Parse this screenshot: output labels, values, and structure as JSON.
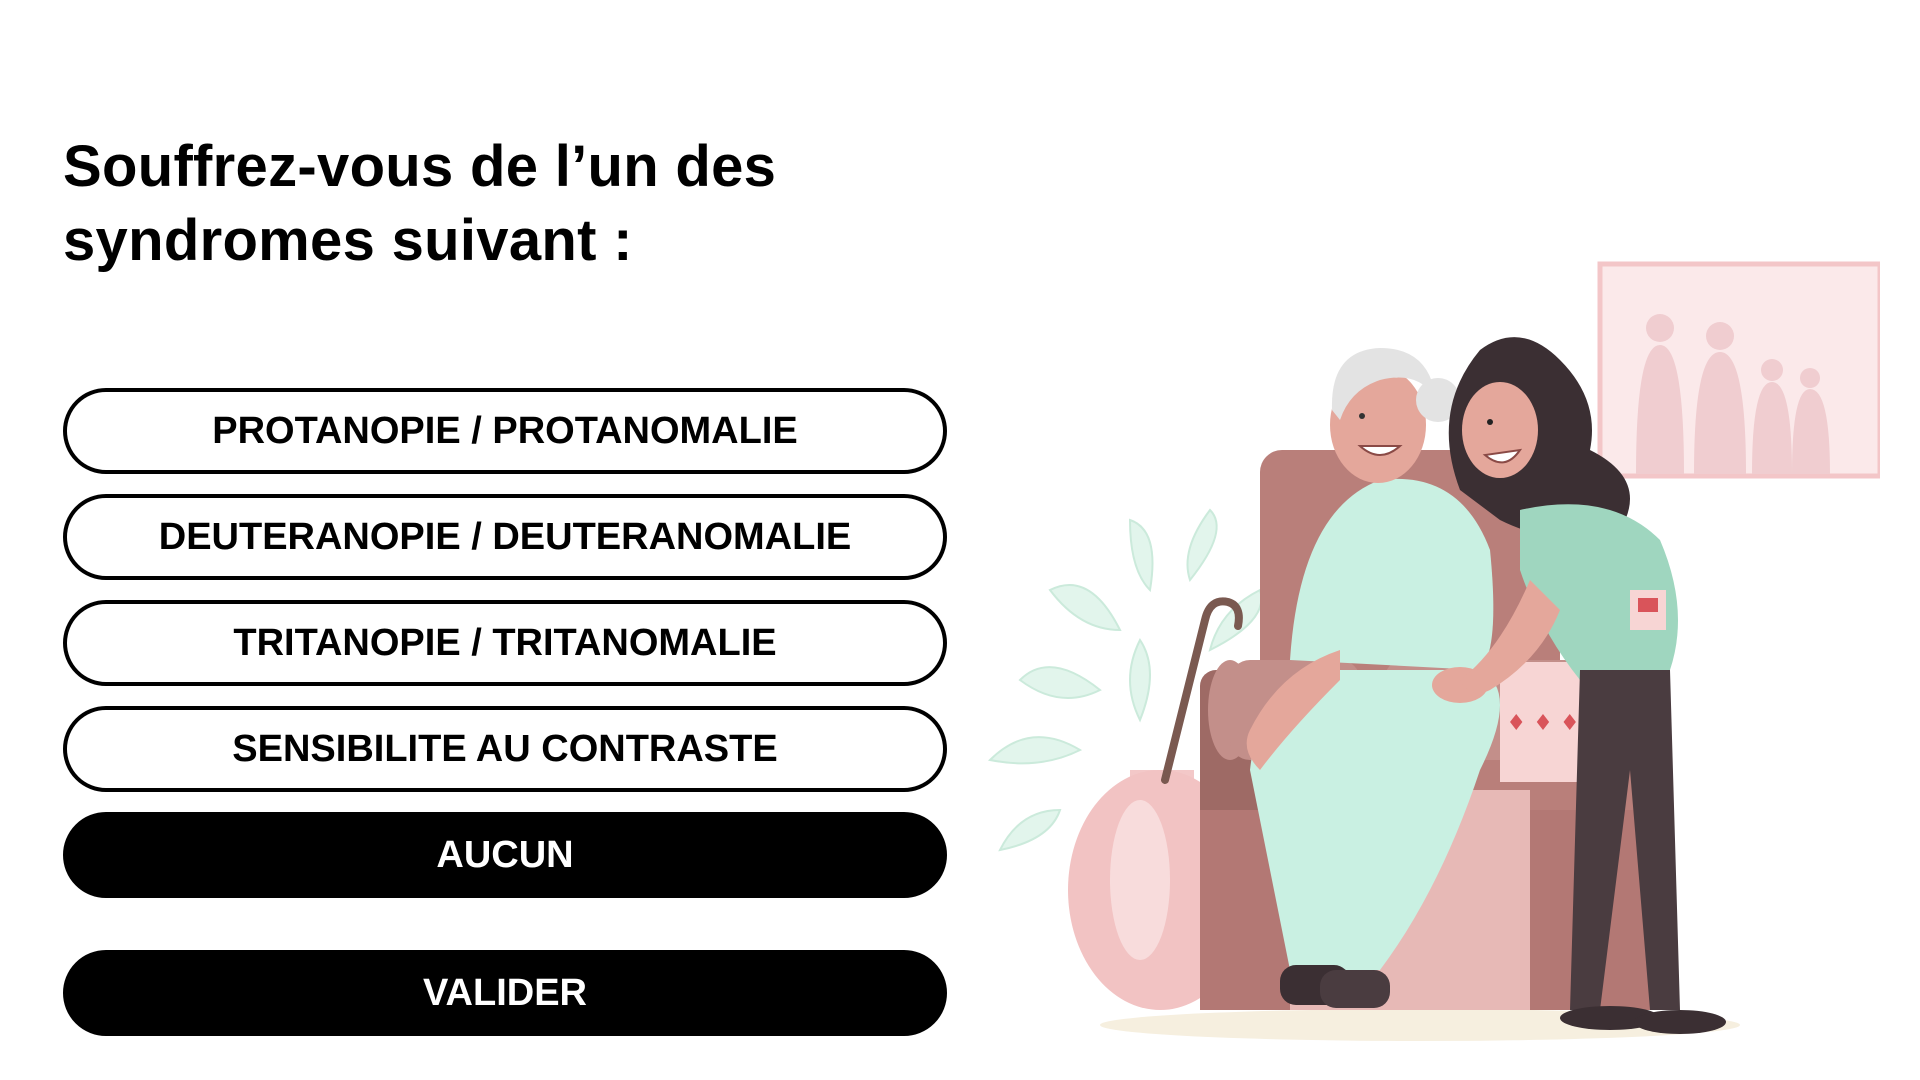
{
  "question": {
    "line1": "Souffrez-vous de l’un des",
    "line2": "syndromes suivant :"
  },
  "options": [
    {
      "label": "PROTANOPIE / PROTANOMALIE",
      "selected": false
    },
    {
      "label": "DEUTERANOPIE / DEUTERANOMALIE",
      "selected": false
    },
    {
      "label": "TRITANOPIE / TRITANOMALIE",
      "selected": false
    },
    {
      "label": "SENSIBILITE AU CONTRASTE",
      "selected": false
    },
    {
      "label": "AUCUN",
      "selected": true
    }
  ],
  "validate_label": "VALIDER",
  "colors": {
    "accent": "#000000",
    "background": "#ffffff",
    "armchair": "#b97f7a",
    "gown": "#c9f0e2",
    "scrubs": "#9fd6bf",
    "frame": "#f3c6c8"
  },
  "illustration": {
    "icon": "caregiver-elderly-illustration"
  }
}
